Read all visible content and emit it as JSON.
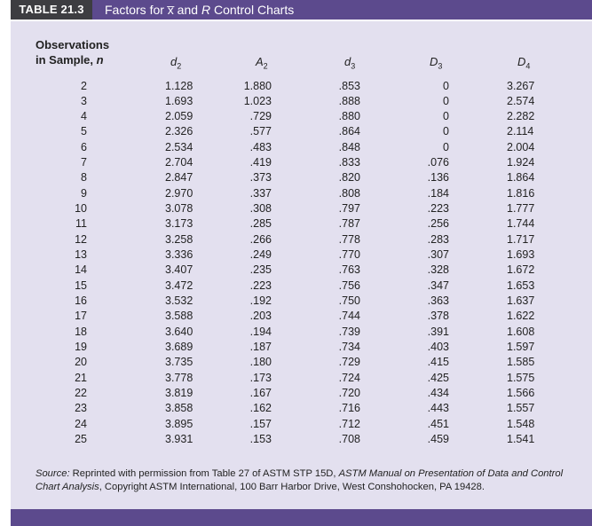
{
  "header": {
    "tag": "TABLE 21.3",
    "title_prefix": "Factors for ",
    "title_xbar": "x̅",
    "title_mid": " and ",
    "title_r": "R",
    "title_suffix": " Control Charts"
  },
  "columns": {
    "obs_line1": "Observations",
    "obs_line2": "in Sample, ",
    "obs_n": "n",
    "d2_base": "d",
    "d2_sub": "2",
    "a2_base": "A",
    "a2_sub": "2",
    "d3_base": "d",
    "d3_sub": "3",
    "D3_base": "D",
    "D3_sub": "3",
    "D4_base": "D",
    "D4_sub": "4"
  },
  "rows": [
    {
      "n": "2",
      "d2": "1.128",
      "a2": "1.880",
      "d3": ".853",
      "D3": "0",
      "D4": "3.267"
    },
    {
      "n": "3",
      "d2": "1.693",
      "a2": "1.023",
      "d3": ".888",
      "D3": "0",
      "D4": "2.574"
    },
    {
      "n": "4",
      "d2": "2.059",
      "a2": ".729",
      "d3": ".880",
      "D3": "0",
      "D4": "2.282"
    },
    {
      "n": "5",
      "d2": "2.326",
      "a2": ".577",
      "d3": ".864",
      "D3": "0",
      "D4": "2.114"
    },
    {
      "n": "6",
      "d2": "2.534",
      "a2": ".483",
      "d3": ".848",
      "D3": "0",
      "D4": "2.004"
    },
    {
      "n": "7",
      "d2": "2.704",
      "a2": ".419",
      "d3": ".833",
      "D3": ".076",
      "D4": "1.924"
    },
    {
      "n": "8",
      "d2": "2.847",
      "a2": ".373",
      "d3": ".820",
      "D3": ".136",
      "D4": "1.864"
    },
    {
      "n": "9",
      "d2": "2.970",
      "a2": ".337",
      "d3": ".808",
      "D3": ".184",
      "D4": "1.816"
    },
    {
      "n": "10",
      "d2": "3.078",
      "a2": ".308",
      "d3": ".797",
      "D3": ".223",
      "D4": "1.777"
    },
    {
      "n": "11",
      "d2": "3.173",
      "a2": ".285",
      "d3": ".787",
      "D3": ".256",
      "D4": "1.744"
    },
    {
      "n": "12",
      "d2": "3.258",
      "a2": ".266",
      "d3": ".778",
      "D3": ".283",
      "D4": "1.717"
    },
    {
      "n": "13",
      "d2": "3.336",
      "a2": ".249",
      "d3": ".770",
      "D3": ".307",
      "D4": "1.693"
    },
    {
      "n": "14",
      "d2": "3.407",
      "a2": ".235",
      "d3": ".763",
      "D3": ".328",
      "D4": "1.672"
    },
    {
      "n": "15",
      "d2": "3.472",
      "a2": ".223",
      "d3": ".756",
      "D3": ".347",
      "D4": "1.653"
    },
    {
      "n": "16",
      "d2": "3.532",
      "a2": ".192",
      "d3": ".750",
      "D3": ".363",
      "D4": "1.637"
    },
    {
      "n": "17",
      "d2": "3.588",
      "a2": ".203",
      "d3": ".744",
      "D3": ".378",
      "D4": "1.622"
    },
    {
      "n": "18",
      "d2": "3.640",
      "a2": ".194",
      "d3": ".739",
      "D3": ".391",
      "D4": "1.608"
    },
    {
      "n": "19",
      "d2": "3.689",
      "a2": ".187",
      "d3": ".734",
      "D3": ".403",
      "D4": "1.597"
    },
    {
      "n": "20",
      "d2": "3.735",
      "a2": ".180",
      "d3": ".729",
      "D3": ".415",
      "D4": "1.585"
    },
    {
      "n": "21",
      "d2": "3.778",
      "a2": ".173",
      "d3": ".724",
      "D3": ".425",
      "D4": "1.575"
    },
    {
      "n": "22",
      "d2": "3.819",
      "a2": ".167",
      "d3": ".720",
      "D3": ".434",
      "D4": "1.566"
    },
    {
      "n": "23",
      "d2": "3.858",
      "a2": ".162",
      "d3": ".716",
      "D3": ".443",
      "D4": "1.557"
    },
    {
      "n": "24",
      "d2": "3.895",
      "a2": ".157",
      "d3": ".712",
      "D3": ".451",
      "D4": "1.548"
    },
    {
      "n": "25",
      "d2": "3.931",
      "a2": ".153",
      "d3": ".708",
      "D3": ".459",
      "D4": "1.541"
    }
  ],
  "source": {
    "label": "Source:",
    "text1": " Reprinted with permission from Table 27 of ASTM STP 15D, ",
    "italic": "ASTM Manual on Presentation of Data and Control Chart Analysis",
    "text2": ", Copyright ASTM International, 100 Barr Harbor Drive, West Conshohocken, PA 19428."
  },
  "colors": {
    "tag_bg": "#3d3d41",
    "title_bg": "#5c4a8d",
    "panel_bg": "#e3e0ef"
  }
}
